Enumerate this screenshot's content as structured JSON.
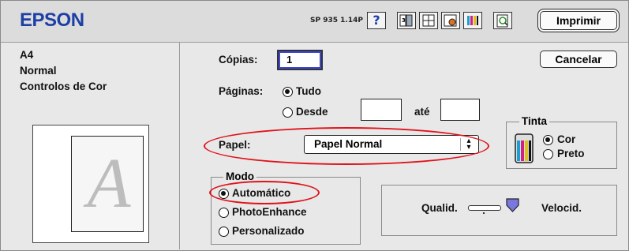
{
  "header": {
    "brand": "EPSON",
    "version": "SP 935 1.14P",
    "help_label": "?",
    "print_button": "Imprimir",
    "cancel_button": "Cancelar",
    "toolbar_icons": [
      "help-icon",
      "layout-icon",
      "advanced-icon",
      "utilities-icon",
      "ink-icon",
      "preview-icon"
    ]
  },
  "summary": {
    "paper_size": "A4",
    "paper_type": "Normal",
    "color_control": "Controlos de Cor",
    "preview_letter": "A"
  },
  "copies": {
    "label": "Cópias:",
    "value": "1"
  },
  "pages": {
    "label": "Páginas:",
    "all_label": "Tudo",
    "range_label": "Desde",
    "to_label": "até",
    "from_value": "",
    "to_value": "",
    "selected": "Tudo"
  },
  "ink": {
    "title": "Tinta",
    "color_label": "Cor",
    "black_label": "Preto",
    "selected": "Cor"
  },
  "paper": {
    "label": "Papel:",
    "value": "Papel Normal"
  },
  "mode": {
    "title": "Modo",
    "options": [
      "Automático",
      "PhotoEnhance",
      "Personalizado"
    ],
    "selected": "Automático"
  },
  "quality": {
    "left_label": "Qualid.",
    "right_label": "Velocid.",
    "level": 1.0
  },
  "annotations": {
    "highlight_color": "#e0121b",
    "brand_color": "#1d3fa6"
  }
}
